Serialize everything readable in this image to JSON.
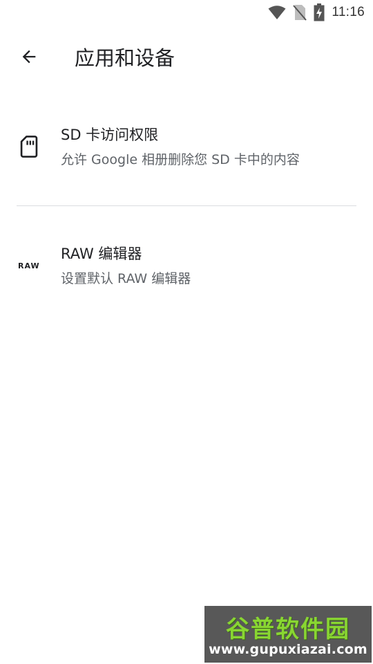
{
  "status_bar": {
    "time": "11:16",
    "icons": [
      "wifi-icon",
      "no-sim-icon",
      "battery-charging-icon"
    ]
  },
  "app_bar": {
    "back_icon": "arrow-back-icon",
    "title": "应用和设备"
  },
  "items": [
    {
      "icon": "sd-card-icon",
      "title": "SD 卡访问权限",
      "subtitle": "允许 Google 相册删除您 SD 卡中的内容"
    },
    {
      "icon": "raw-icon",
      "icon_text": "RAW",
      "title": "RAW 编辑器",
      "subtitle": "设置默认 RAW 编辑器"
    }
  ],
  "watermark": {
    "brand": "谷普软件园",
    "url": "www.gupuxiazai.com"
  },
  "colors": {
    "text_primary": "#202124",
    "text_secondary": "#5f6368",
    "divider": "#dadce0",
    "watermark_green": "#7fd321"
  }
}
